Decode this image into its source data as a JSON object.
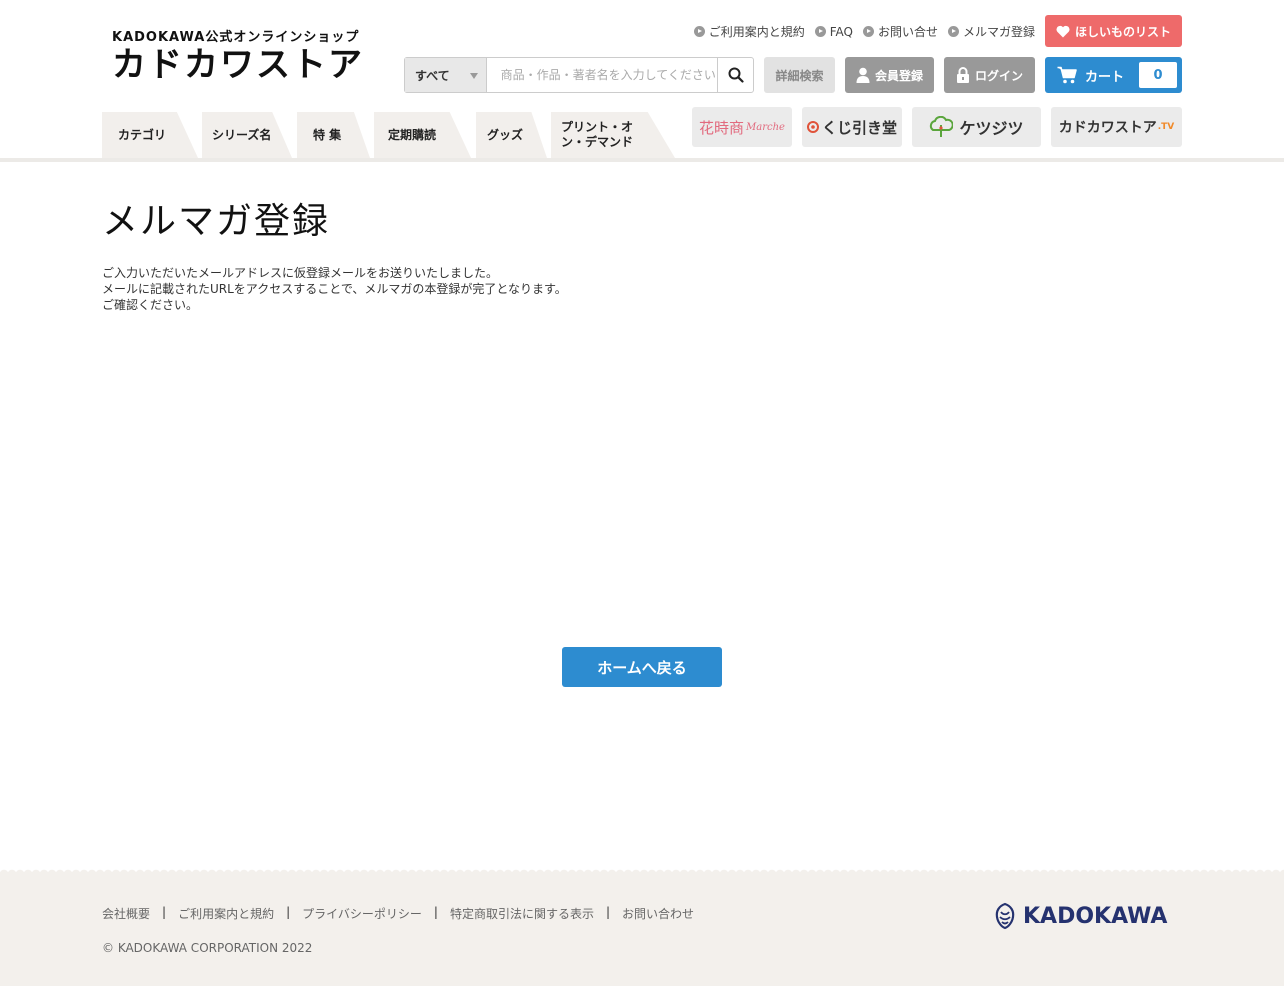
{
  "header": {
    "logo_sub": "KADOKAWA公式オンラインショップ",
    "logo_main": "カドカワストア",
    "top_links": [
      "ご利用案内と規約",
      "FAQ",
      "お問い合せ",
      "メルマガ登録"
    ],
    "wishlist_label": "ほしいものリスト",
    "search": {
      "category_selected": "すべて",
      "placeholder": "商品・作品・著者名を入力してください"
    },
    "advanced_search_label": "詳細検索",
    "register_label": "会員登録",
    "login_label": "ログイン",
    "cart_label": "カート",
    "cart_count": "0"
  },
  "nav": {
    "tabs": [
      "カテゴリ",
      "シリーズ名",
      "特 集",
      "定期購読",
      "グッズ",
      "プリント・オン・デマンド"
    ],
    "partners": {
      "marche": "花時商",
      "marche_sub": "Marche",
      "kujibikido": "くじ引き堂",
      "ketsujitsu": "ケツジツ",
      "kadokawa_store_tv": "カドカワストア",
      "kadokawa_store_tv_suffix": ".TV"
    }
  },
  "main": {
    "title": "メルマガ登録",
    "message_lines": [
      "ご入力いただいたメールアドレスに仮登録メールをお送りいたしました。",
      "メールに記載されたURLをアクセスすることで、メルマガの本登録が完了となります。",
      "ご確認ください。"
    ],
    "home_button": "ホームへ戻る"
  },
  "footer": {
    "links": [
      "会社概要",
      "ご利用案内と規約",
      "プライバシーポリシー",
      "特定商取引法に関する表示",
      "お問い合わせ"
    ],
    "separator": "|",
    "copyright": "© KADOKAWA CORPORATION 2022",
    "brand": "KADOKAWA"
  },
  "colors": {
    "accent_blue": "#2d8cd0",
    "wishlist_red": "#ee6a6a",
    "button_gray": "#999999",
    "tab_bg": "#f2efec",
    "footer_bg": "#f3f0ec",
    "brand_navy": "#25326f"
  }
}
